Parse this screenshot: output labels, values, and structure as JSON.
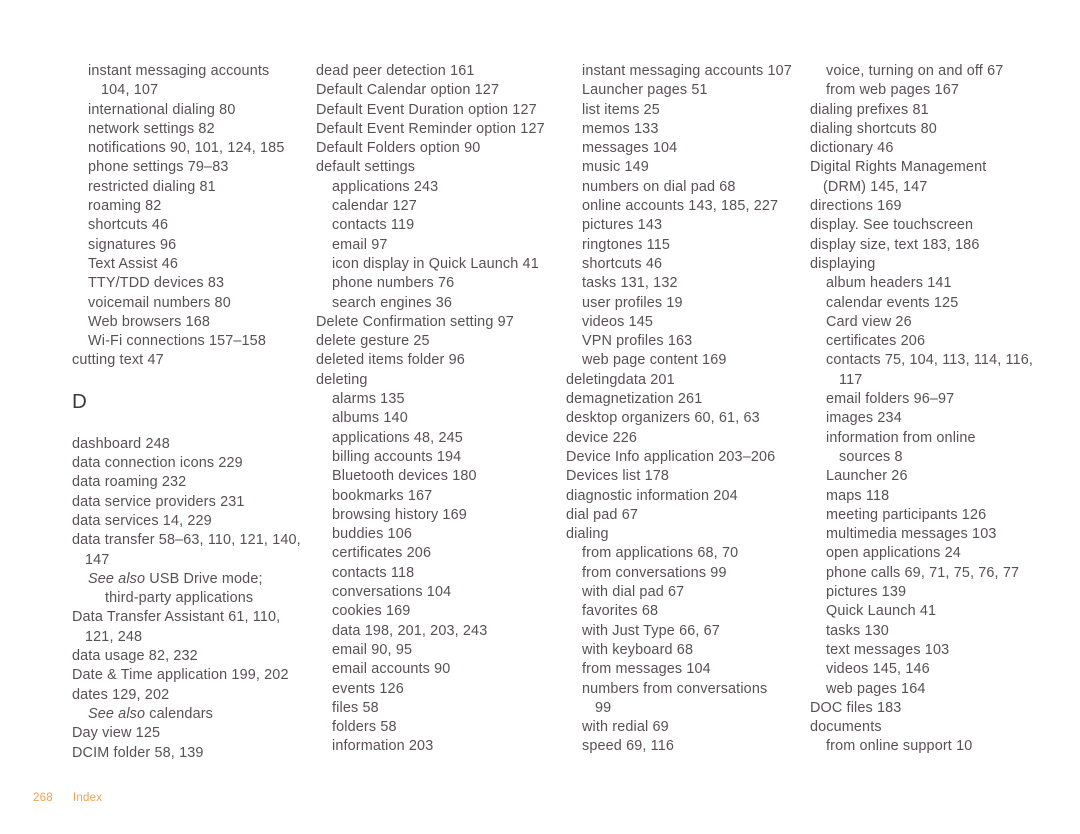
{
  "page": {
    "footer": {
      "page_number": "268",
      "section_label": "Index"
    },
    "letter_heading": "D",
    "accent_color": "#F3A14F",
    "text_color": "#595056"
  },
  "columns": [
    {
      "id": "column-1",
      "entries": [
        {
          "level": 1,
          "text": "instant messaging accounts",
          "cont": "104, 107"
        },
        {
          "level": 1,
          "text": "international dialing 80"
        },
        {
          "level": 1,
          "text": "network settings 82"
        },
        {
          "level": 1,
          "text": "notifications 90, 101, 124, 185"
        },
        {
          "level": 1,
          "text": "phone settings 79–83"
        },
        {
          "level": 1,
          "text": "restricted dialing 81"
        },
        {
          "level": 1,
          "text": "roaming 82"
        },
        {
          "level": 1,
          "text": "shortcuts 46"
        },
        {
          "level": 1,
          "text": "signatures 96"
        },
        {
          "level": 1,
          "text": "Text Assist 46"
        },
        {
          "level": 1,
          "text": "TTY/TDD devices 83"
        },
        {
          "level": 1,
          "text": "voicemail numbers 80"
        },
        {
          "level": 1,
          "text": "Web browsers 168"
        },
        {
          "level": 1,
          "text": "Wi-Fi connections 157–158"
        },
        {
          "level": 0,
          "text": "cutting text 47"
        },
        {
          "level": 0,
          "heading": "D"
        },
        {
          "level": 0,
          "text": "dashboard 248"
        },
        {
          "level": 0,
          "text": "data connection icons 229"
        },
        {
          "level": 0,
          "text": "data roaming 232"
        },
        {
          "level": 0,
          "text": "data service providers 231"
        },
        {
          "level": 0,
          "text": "data services 14, 229"
        },
        {
          "level": 0,
          "text": "data transfer 58–63, 110, 121, 140,",
          "cont": "147"
        },
        {
          "level": 1,
          "seealso": "See also",
          "text": " USB Drive mode;",
          "cont2": "third-party applications"
        },
        {
          "level": 0,
          "text": "Data Transfer Assistant 61, 110,",
          "cont": "121, 248"
        },
        {
          "level": 0,
          "text": "data usage 82, 232"
        },
        {
          "level": 0,
          "text": "Date & Time application 199, 202"
        },
        {
          "level": 0,
          "text": "dates 129, 202"
        },
        {
          "level": 1,
          "seealso": "See also",
          "text": " calendars"
        },
        {
          "level": 0,
          "text": "Day view 125"
        },
        {
          "level": 0,
          "text": "DCIM folder 58, 139"
        }
      ]
    },
    {
      "id": "column-2",
      "entries": [
        {
          "level": 0,
          "text": "dead peer detection 161"
        },
        {
          "level": 0,
          "text": "Default Calendar option 127"
        },
        {
          "level": 0,
          "text": "Default Event Duration option 127"
        },
        {
          "level": 0,
          "text": "Default Event Reminder option 127"
        },
        {
          "level": 0,
          "text": "Default Folders option 90"
        },
        {
          "level": 0,
          "text": "default settings"
        },
        {
          "level": 1,
          "text": "applications 243"
        },
        {
          "level": 1,
          "text": "calendar 127"
        },
        {
          "level": 1,
          "text": "contacts 119"
        },
        {
          "level": 1,
          "text": "email 97"
        },
        {
          "level": 1,
          "text": "icon display in Quick Launch 41"
        },
        {
          "level": 1,
          "text": "phone numbers 76"
        },
        {
          "level": 1,
          "text": "search engines 36"
        },
        {
          "level": 0,
          "text": "Delete Confirmation setting 97"
        },
        {
          "level": 0,
          "text": "delete gesture 25"
        },
        {
          "level": 0,
          "text": "deleted items folder 96"
        },
        {
          "level": 0,
          "text": "deleting"
        },
        {
          "level": 1,
          "text": "alarms 135"
        },
        {
          "level": 1,
          "text": "albums 140"
        },
        {
          "level": 1,
          "text": "applications 48, 245"
        },
        {
          "level": 1,
          "text": "billing accounts 194"
        },
        {
          "level": 1,
          "text": "Bluetooth devices 180"
        },
        {
          "level": 1,
          "text": "bookmarks 167"
        },
        {
          "level": 1,
          "text": "browsing history 169"
        },
        {
          "level": 1,
          "text": "buddies 106"
        },
        {
          "level": 1,
          "text": "certificates 206"
        },
        {
          "level": 1,
          "text": "contacts 118"
        },
        {
          "level": 1,
          "text": "conversations 104"
        },
        {
          "level": 1,
          "text": "cookies 169"
        },
        {
          "level": 1,
          "text": "data 198, 201, 203, 243"
        },
        {
          "level": 1,
          "text": "email 90, 95"
        },
        {
          "level": 1,
          "text": "email accounts 90"
        },
        {
          "level": 1,
          "text": "events 126"
        },
        {
          "level": 1,
          "text": "files 58"
        },
        {
          "level": 1,
          "text": "folders 58"
        },
        {
          "level": 1,
          "text": "information 203"
        }
      ]
    },
    {
      "id": "column-3",
      "entries": [
        {
          "level": 1,
          "text": "instant messaging accounts 107"
        },
        {
          "level": 1,
          "text": "Launcher pages 51"
        },
        {
          "level": 1,
          "text": "list items 25"
        },
        {
          "level": 1,
          "text": "memos 133"
        },
        {
          "level": 1,
          "text": "messages 104"
        },
        {
          "level": 1,
          "text": "music 149"
        },
        {
          "level": 1,
          "text": "numbers on dial pad 68"
        },
        {
          "level": 1,
          "text": "online accounts 143, 185, 227"
        },
        {
          "level": 1,
          "text": "pictures 143"
        },
        {
          "level": 1,
          "text": "ringtones 115"
        },
        {
          "level": 1,
          "text": "shortcuts 46"
        },
        {
          "level": 1,
          "text": "tasks 131, 132"
        },
        {
          "level": 1,
          "text": "user profiles 19"
        },
        {
          "level": 1,
          "text": "videos 145"
        },
        {
          "level": 1,
          "text": "VPN profiles 163"
        },
        {
          "level": 1,
          "text": "web page content 169"
        },
        {
          "level": 0,
          "text": "deletingdata 201"
        },
        {
          "level": 0,
          "text": "demagnetization 261"
        },
        {
          "level": 0,
          "text": "desktop organizers 60, 61, 63"
        },
        {
          "level": 0,
          "text": "device 226"
        },
        {
          "level": 0,
          "text": "Device Info application 203–206"
        },
        {
          "level": 0,
          "text": "Devices list 178"
        },
        {
          "level": 0,
          "text": "diagnostic information 204"
        },
        {
          "level": 0,
          "text": "dial pad 67"
        },
        {
          "level": 0,
          "text": "dialing"
        },
        {
          "level": 1,
          "text": "from applications 68, 70"
        },
        {
          "level": 1,
          "text": "from conversations 99"
        },
        {
          "level": 1,
          "text": "with dial pad 67"
        },
        {
          "level": 1,
          "text": "favorites 68"
        },
        {
          "level": 1,
          "text": "with Just Type 66, 67"
        },
        {
          "level": 1,
          "text": "with keyboard 68"
        },
        {
          "level": 1,
          "text": "from messages 104"
        },
        {
          "level": 1,
          "text": "numbers from conversations",
          "cont": "99"
        },
        {
          "level": 1,
          "text": "with redial 69"
        },
        {
          "level": 1,
          "text": "speed 69, 116"
        }
      ]
    },
    {
      "id": "column-4",
      "entries": [
        {
          "level": 1,
          "text": "voice, turning on and off 67"
        },
        {
          "level": 1,
          "text": "from web pages 167"
        },
        {
          "level": 0,
          "text": "dialing prefixes 81"
        },
        {
          "level": 0,
          "text": "dialing shortcuts 80"
        },
        {
          "level": 0,
          "text": "dictionary 46"
        },
        {
          "level": 0,
          "text": "Digital Rights Management",
          "cont": "(DRM) 145, 147"
        },
        {
          "level": 0,
          "text": "directions 169"
        },
        {
          "level": 0,
          "text": "display. See touchscreen"
        },
        {
          "level": 0,
          "text": "display size, text 183, 186"
        },
        {
          "level": 0,
          "text": "displaying"
        },
        {
          "level": 1,
          "text": "album headers 141"
        },
        {
          "level": 1,
          "text": "calendar events 125"
        },
        {
          "level": 1,
          "text": "Card view 26"
        },
        {
          "level": 1,
          "text": "certificates 206"
        },
        {
          "level": 1,
          "text": "contacts 75, 104, 113, 114, 116,",
          "cont": "117"
        },
        {
          "level": 1,
          "text": "email folders 96–97"
        },
        {
          "level": 1,
          "text": "images 234"
        },
        {
          "level": 1,
          "text": "information from online",
          "cont": "sources 8"
        },
        {
          "level": 1,
          "text": "Launcher 26"
        },
        {
          "level": 1,
          "text": "maps 118"
        },
        {
          "level": 1,
          "text": "meeting participants 126"
        },
        {
          "level": 1,
          "text": "multimedia messages 103"
        },
        {
          "level": 1,
          "text": "open applications 24"
        },
        {
          "level": 1,
          "text": "phone calls 69, 71, 75, 76, 77"
        },
        {
          "level": 1,
          "text": "pictures 139"
        },
        {
          "level": 1,
          "text": "Quick Launch 41"
        },
        {
          "level": 1,
          "text": "tasks 130"
        },
        {
          "level": 1,
          "text": "text messages 103"
        },
        {
          "level": 1,
          "text": "videos 145, 146"
        },
        {
          "level": 1,
          "text": "web pages 164"
        },
        {
          "level": 0,
          "text": "DOC files 183"
        },
        {
          "level": 0,
          "text": "documents"
        },
        {
          "level": 1,
          "text": "from online support 10"
        }
      ]
    }
  ]
}
